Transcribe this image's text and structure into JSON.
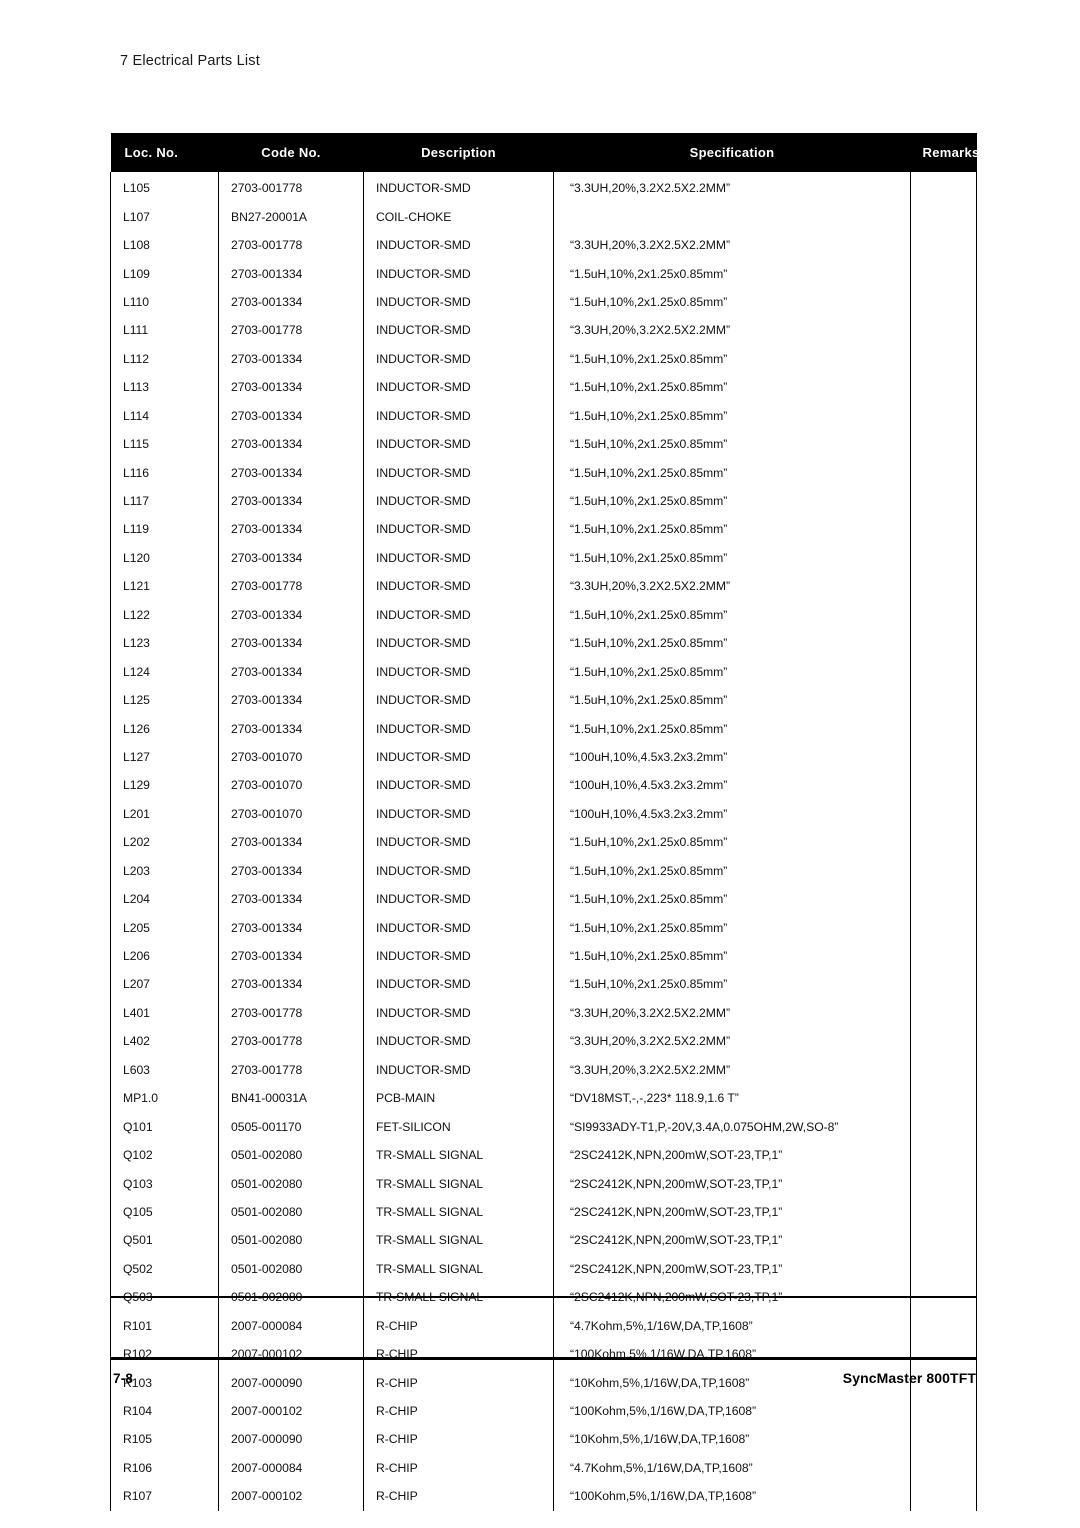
{
  "document": {
    "running_head": "7 Electrical Parts List",
    "footer": {
      "page_number": "7-8",
      "model": "SyncMaster 800TFT"
    }
  },
  "table": {
    "columns": [
      {
        "key": "loc",
        "label": "Loc. No."
      },
      {
        "key": "code",
        "label": "Code No."
      },
      {
        "key": "desc",
        "label": "Description"
      },
      {
        "key": "spec",
        "label": "Specification"
      },
      {
        "key": "rem",
        "label": "Remarks"
      }
    ],
    "rows": [
      {
        "loc": "L105",
        "code": "2703-001778",
        "desc": "INDUCTOR-SMD",
        "spec": "“3.3UH,20%,3.2X2.5X2.2MM”",
        "rem": ""
      },
      {
        "loc": "L107",
        "code": "BN27-20001A",
        "desc": "COIL-CHOKE",
        "spec": "",
        "rem": ""
      },
      {
        "loc": "L108",
        "code": "2703-001778",
        "desc": "INDUCTOR-SMD",
        "spec": "“3.3UH,20%,3.2X2.5X2.2MM”",
        "rem": ""
      },
      {
        "loc": "L109",
        "code": "2703-001334",
        "desc": "INDUCTOR-SMD",
        "spec": "“1.5uH,10%,2x1.25x0.85mm”",
        "rem": ""
      },
      {
        "loc": "L110",
        "code": "2703-001334",
        "desc": "INDUCTOR-SMD",
        "spec": "“1.5uH,10%,2x1.25x0.85mm”",
        "rem": ""
      },
      {
        "loc": "L111",
        "code": "2703-001778",
        "desc": "INDUCTOR-SMD",
        "spec": "“3.3UH,20%,3.2X2.5X2.2MM”",
        "rem": ""
      },
      {
        "loc": "L112",
        "code": "2703-001334",
        "desc": "INDUCTOR-SMD",
        "spec": "“1.5uH,10%,2x1.25x0.85mm”",
        "rem": ""
      },
      {
        "loc": "L113",
        "code": "2703-001334",
        "desc": "INDUCTOR-SMD",
        "spec": "“1.5uH,10%,2x1.25x0.85mm”",
        "rem": ""
      },
      {
        "loc": "L114",
        "code": "2703-001334",
        "desc": "INDUCTOR-SMD",
        "spec": "“1.5uH,10%,2x1.25x0.85mm”",
        "rem": ""
      },
      {
        "loc": "L115",
        "code": "2703-001334",
        "desc": "INDUCTOR-SMD",
        "spec": "“1.5uH,10%,2x1.25x0.85mm”",
        "rem": ""
      },
      {
        "loc": "L116",
        "code": "2703-001334",
        "desc": "INDUCTOR-SMD",
        "spec": "“1.5uH,10%,2x1.25x0.85mm”",
        "rem": ""
      },
      {
        "loc": "L117",
        "code": "2703-001334",
        "desc": "INDUCTOR-SMD",
        "spec": "“1.5uH,10%,2x1.25x0.85mm”",
        "rem": ""
      },
      {
        "loc": "L119",
        "code": "2703-001334",
        "desc": "INDUCTOR-SMD",
        "spec": "“1.5uH,10%,2x1.25x0.85mm”",
        "rem": ""
      },
      {
        "loc": "L120",
        "code": "2703-001334",
        "desc": "INDUCTOR-SMD",
        "spec": "“1.5uH,10%,2x1.25x0.85mm”",
        "rem": ""
      },
      {
        "loc": "L121",
        "code": "2703-001778",
        "desc": "INDUCTOR-SMD",
        "spec": "“3.3UH,20%,3.2X2.5X2.2MM”",
        "rem": ""
      },
      {
        "loc": "L122",
        "code": "2703-001334",
        "desc": "INDUCTOR-SMD",
        "spec": "“1.5uH,10%,2x1.25x0.85mm”",
        "rem": ""
      },
      {
        "loc": "L123",
        "code": "2703-001334",
        "desc": "INDUCTOR-SMD",
        "spec": "“1.5uH,10%,2x1.25x0.85mm”",
        "rem": ""
      },
      {
        "loc": "L124",
        "code": "2703-001334",
        "desc": "INDUCTOR-SMD",
        "spec": "“1.5uH,10%,2x1.25x0.85mm”",
        "rem": ""
      },
      {
        "loc": "L125",
        "code": "2703-001334",
        "desc": "INDUCTOR-SMD",
        "spec": "“1.5uH,10%,2x1.25x0.85mm”",
        "rem": ""
      },
      {
        "loc": "L126",
        "code": "2703-001334",
        "desc": "INDUCTOR-SMD",
        "spec": "“1.5uH,10%,2x1.25x0.85mm”",
        "rem": ""
      },
      {
        "loc": "L127",
        "code": "2703-001070",
        "desc": "INDUCTOR-SMD",
        "spec": "“100uH,10%,4.5x3.2x3.2mm”",
        "rem": ""
      },
      {
        "loc": "L129",
        "code": "2703-001070",
        "desc": "INDUCTOR-SMD",
        "spec": "“100uH,10%,4.5x3.2x3.2mm”",
        "rem": ""
      },
      {
        "loc": "L201",
        "code": "2703-001070",
        "desc": "INDUCTOR-SMD",
        "spec": "“100uH,10%,4.5x3.2x3.2mm”",
        "rem": ""
      },
      {
        "loc": "L202",
        "code": "2703-001334",
        "desc": "INDUCTOR-SMD",
        "spec": "“1.5uH,10%,2x1.25x0.85mm”",
        "rem": ""
      },
      {
        "loc": "L203",
        "code": "2703-001334",
        "desc": "INDUCTOR-SMD",
        "spec": "“1.5uH,10%,2x1.25x0.85mm”",
        "rem": ""
      },
      {
        "loc": "L204",
        "code": "2703-001334",
        "desc": "INDUCTOR-SMD",
        "spec": "“1.5uH,10%,2x1.25x0.85mm”",
        "rem": ""
      },
      {
        "loc": "L205",
        "code": "2703-001334",
        "desc": "INDUCTOR-SMD",
        "spec": "“1.5uH,10%,2x1.25x0.85mm”",
        "rem": ""
      },
      {
        "loc": "L206",
        "code": "2703-001334",
        "desc": "INDUCTOR-SMD",
        "spec": "“1.5uH,10%,2x1.25x0.85mm”",
        "rem": ""
      },
      {
        "loc": "L207",
        "code": "2703-001334",
        "desc": "INDUCTOR-SMD",
        "spec": "“1.5uH,10%,2x1.25x0.85mm”",
        "rem": ""
      },
      {
        "loc": "L401",
        "code": "2703-001778",
        "desc": "INDUCTOR-SMD",
        "spec": "“3.3UH,20%,3.2X2.5X2.2MM”",
        "rem": ""
      },
      {
        "loc": "L402",
        "code": "2703-001778",
        "desc": "INDUCTOR-SMD",
        "spec": "“3.3UH,20%,3.2X2.5X2.2MM”",
        "rem": ""
      },
      {
        "loc": "L603",
        "code": "2703-001778",
        "desc": "INDUCTOR-SMD",
        "spec": "“3.3UH,20%,3.2X2.5X2.2MM”",
        "rem": ""
      },
      {
        "loc": "MP1.0",
        "code": "BN41-00031A",
        "desc": "PCB-MAIN",
        "spec": "“DV18MST,-,-,223* 118.9,1.6 T”",
        "rem": ""
      },
      {
        "loc": "Q101",
        "code": "0505-001170",
        "desc": "FET-SILICON",
        "spec": "“SI9933ADY-T1,P,-20V,3.4A,0.075OHM,2W,SO-8”",
        "rem": ""
      },
      {
        "loc": "Q102",
        "code": "0501-002080",
        "desc": "TR-SMALL SIGNAL",
        "spec": "“2SC2412K,NPN,200mW,SOT-23,TP,1”",
        "rem": ""
      },
      {
        "loc": "Q103",
        "code": "0501-002080",
        "desc": "TR-SMALL SIGNAL",
        "spec": "“2SC2412K,NPN,200mW,SOT-23,TP,1”",
        "rem": ""
      },
      {
        "loc": "Q105",
        "code": "0501-002080",
        "desc": "TR-SMALL SIGNAL",
        "spec": "“2SC2412K,NPN,200mW,SOT-23,TP,1”",
        "rem": ""
      },
      {
        "loc": "Q501",
        "code": "0501-002080",
        "desc": "TR-SMALL SIGNAL",
        "spec": "“2SC2412K,NPN,200mW,SOT-23,TP,1”",
        "rem": ""
      },
      {
        "loc": "Q502",
        "code": "0501-002080",
        "desc": "TR-SMALL SIGNAL",
        "spec": "“2SC2412K,NPN,200mW,SOT-23,TP,1”",
        "rem": ""
      },
      {
        "loc": "Q503",
        "code": "0501-002080",
        "desc": "TR-SMALL SIGNAL",
        "spec": "“2SC2412K,NPN,200mW,SOT-23,TP,1”",
        "rem": ""
      },
      {
        "loc": "R101",
        "code": "2007-000084",
        "desc": "R-CHIP",
        "spec": "“4.7Kohm,5%,1/16W,DA,TP,1608”",
        "rem": ""
      },
      {
        "loc": "R102",
        "code": "2007-000102",
        "desc": "R-CHIP",
        "spec": "“100Kohm,5%,1/16W,DA,TP,1608”",
        "rem": ""
      },
      {
        "loc": "R103",
        "code": "2007-000090",
        "desc": "R-CHIP",
        "spec": "“10Kohm,5%,1/16W,DA,TP,1608”",
        "rem": ""
      },
      {
        "loc": "R104",
        "code": "2007-000102",
        "desc": "R-CHIP",
        "spec": "“100Kohm,5%,1/16W,DA,TP,1608”",
        "rem": ""
      },
      {
        "loc": "R105",
        "code": "2007-000090",
        "desc": "R-CHIP",
        "spec": "“10Kohm,5%,1/16W,DA,TP,1608”",
        "rem": ""
      },
      {
        "loc": "R106",
        "code": "2007-000084",
        "desc": "R-CHIP",
        "spec": "“4.7Kohm,5%,1/16W,DA,TP,1608”",
        "rem": ""
      },
      {
        "loc": "R107",
        "code": "2007-000102",
        "desc": "R-CHIP",
        "spec": "“100Kohm,5%,1/16W,DA,TP,1608”",
        "rem": ""
      }
    ]
  }
}
